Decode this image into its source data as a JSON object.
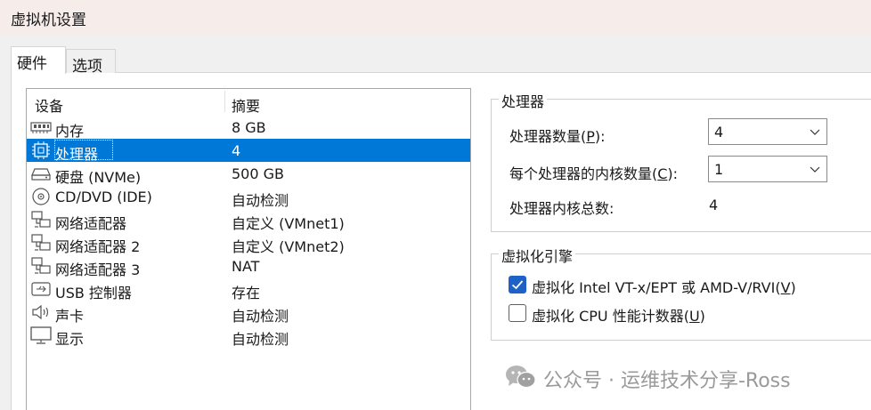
{
  "window": {
    "title": "虚拟机设置"
  },
  "tabs": [
    {
      "label": "硬件",
      "active": true
    },
    {
      "label": "选项",
      "active": false
    }
  ],
  "device_list": {
    "headers": {
      "device": "设备",
      "summary": "摘要"
    },
    "rows": [
      {
        "icon": "memory-icon",
        "name": "内存",
        "summary": "8 GB"
      },
      {
        "icon": "cpu-icon",
        "name": "处理器",
        "summary": "4",
        "selected": true
      },
      {
        "icon": "disk-icon",
        "name": "硬盘 (NVMe)",
        "summary": "500 GB"
      },
      {
        "icon": "cd-icon",
        "name": "CD/DVD (IDE)",
        "summary": "自动检测"
      },
      {
        "icon": "network-icon",
        "name": "网络适配器",
        "summary": "自定义 (VMnet1)"
      },
      {
        "icon": "network-icon",
        "name": "网络适配器 2",
        "summary": "自定义 (VMnet2)"
      },
      {
        "icon": "network-icon",
        "name": "网络适配器 3",
        "summary": "NAT"
      },
      {
        "icon": "usb-icon",
        "name": "USB 控制器",
        "summary": "存在"
      },
      {
        "icon": "speaker-icon",
        "name": "声卡",
        "summary": "自动检测"
      },
      {
        "icon": "monitor-icon",
        "name": "显示",
        "summary": "自动检测"
      }
    ]
  },
  "processor": {
    "group_label": "处理器",
    "count_label_pre": "处理器数量(",
    "count_label_key": "P",
    "count_label_post": "):",
    "count_value": "4",
    "cores_label_pre": "每个处理器的内核数量(",
    "cores_label_key": "C",
    "cores_label_post": "):",
    "cores_value": "1",
    "total_label": "处理器内核总数:",
    "total_value": "4"
  },
  "virtualization": {
    "group_label": "虚拟化引擎",
    "vtx_label_pre": "虚拟化 Intel VT-x/EPT 或 AMD-V/RVI(",
    "vtx_label_key": "V",
    "vtx_label_post": ")",
    "vtx_checked": true,
    "cpu_counter_label_pre": "虚拟化 CPU 性能计数器(",
    "cpu_counter_label_key": "U",
    "cpu_counter_label_post": ")",
    "cpu_counter_checked": false
  },
  "watermark": {
    "text": "公众号 · 运维技术分享-Ross"
  },
  "colors": {
    "selection": "#0078d7",
    "checkbox_checked": "#1e62c8",
    "titlebar": "#f6ecea"
  }
}
